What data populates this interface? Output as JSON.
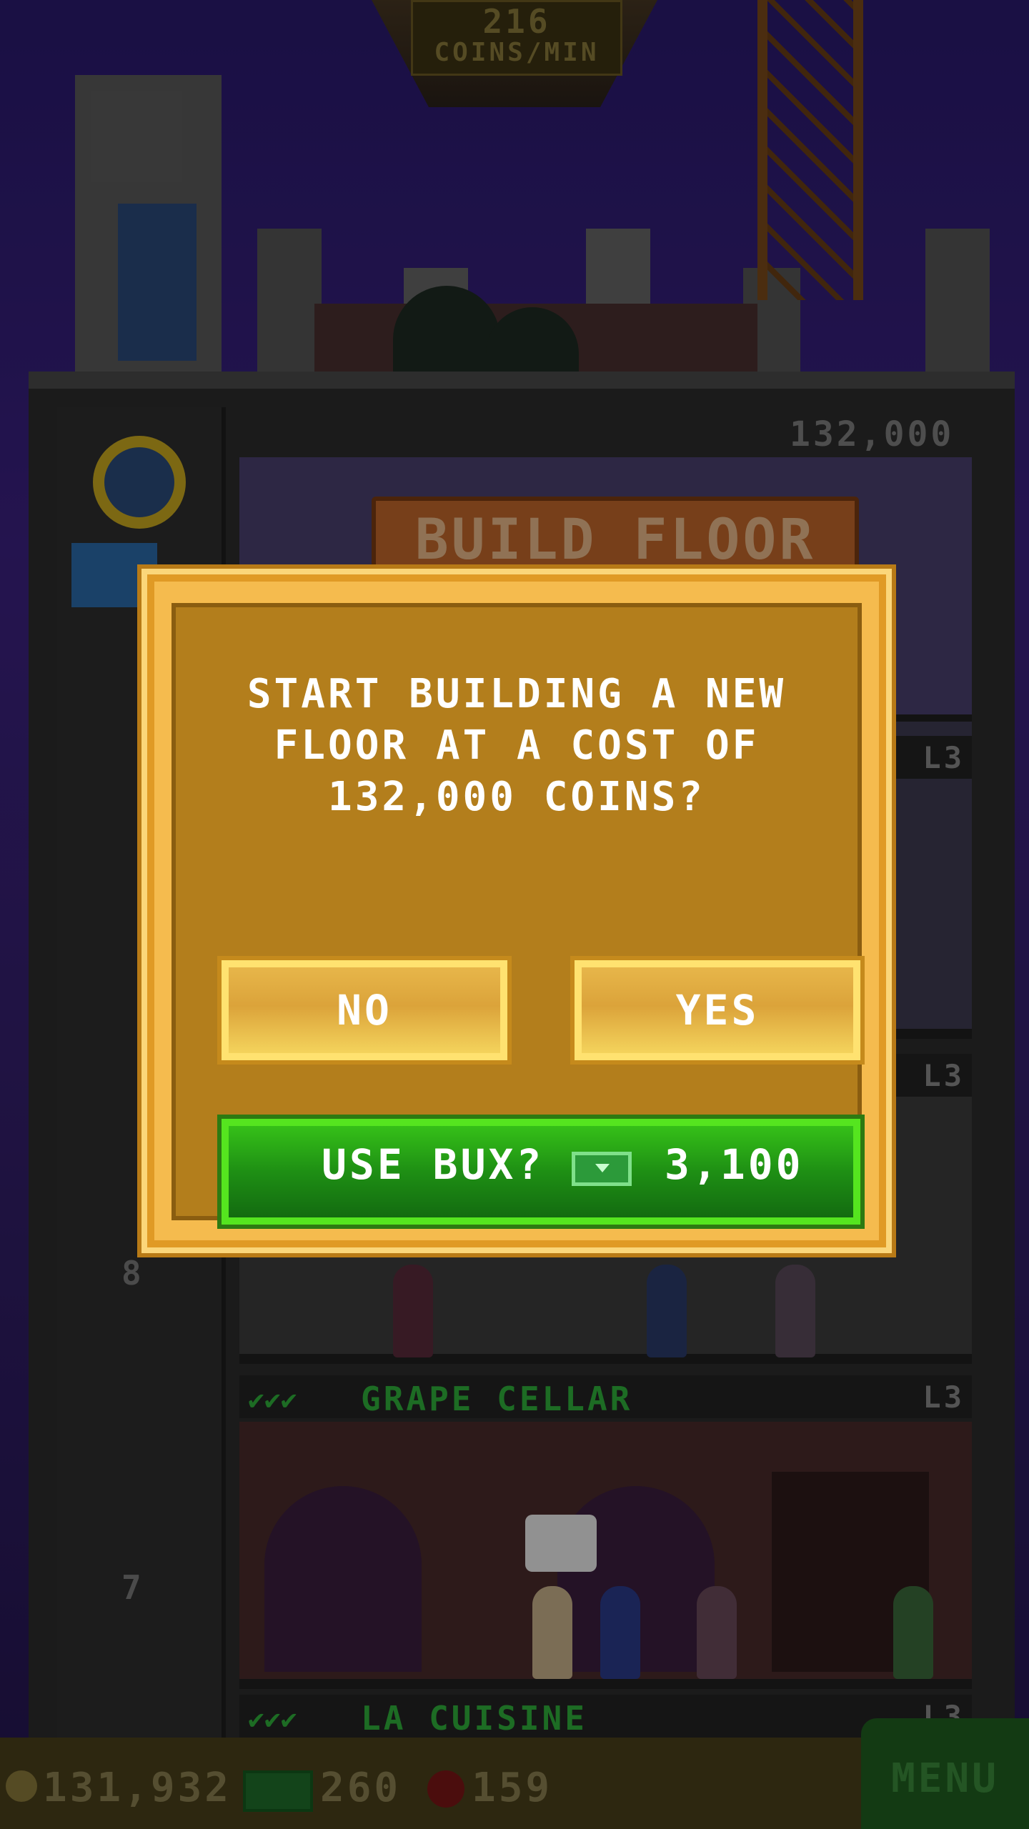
{
  "hud": {
    "coin_rate": "216",
    "coin_rate_unit": "COINS/MIN",
    "coins": "131,932",
    "bux": "260",
    "gems": "159",
    "menu_label": "MENU"
  },
  "tower": {
    "next_floor_cost": "132,000",
    "build_floor_label": "BUILD FLOOR",
    "floor_numbers": [
      "8",
      "7"
    ],
    "floors": [
      {
        "name": "GRAPE CELLAR",
        "level": "L3",
        "checks": "✔✔✔"
      },
      {
        "name": "LA CUISINE",
        "level": "L3",
        "checks": "✔✔✔"
      }
    ],
    "hidden_levels": [
      "L3",
      "L3"
    ]
  },
  "dialog": {
    "message": "START BUILDING A NEW\nFLOOR AT A COST OF\n132,000 COINS?",
    "no_label": "NO",
    "yes_label": "YES",
    "bux_label": "USE BUX?",
    "bux_cost": "3,100"
  },
  "icons": {
    "coin": "coin-icon",
    "bux": "bux-icon",
    "gem": "gem-icon",
    "pulley": "elevator-pulley-icon"
  },
  "colors": {
    "dialog_gold": "#f5bb4e",
    "dialog_panel": "#b37e1c",
    "green_button": "#1e8f14",
    "floor_name_green": "#2fae3a"
  }
}
